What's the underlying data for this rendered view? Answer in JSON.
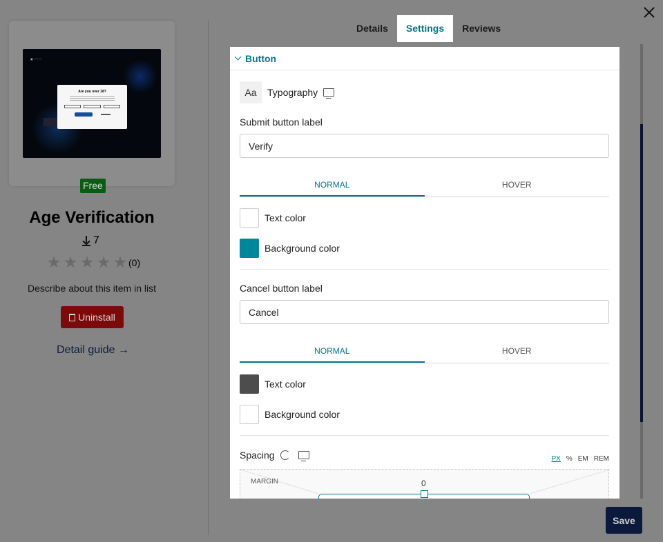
{
  "app": {
    "title": "Age Verification",
    "price_badge": "Free",
    "downloads": "7",
    "rating_count": "(0)",
    "description": "Describe about this item in list",
    "uninstall_label": "Uninstall",
    "detail_guide_label": "Detail guide →",
    "stars": 5,
    "rating_value": 0,
    "thumbnail": {
      "modal_title": "Are you over 18?"
    }
  },
  "tabs": [
    {
      "label": "Details",
      "active": false
    },
    {
      "label": "Settings",
      "active": true
    },
    {
      "label": "Reviews",
      "active": false
    }
  ],
  "panel": {
    "section_title": "Button",
    "typography_icon_text": "Aa",
    "typography_label": "Typography",
    "submit": {
      "label": "Submit button label",
      "value": "Verify",
      "state_tabs": [
        "NORMAL",
        "HOVER"
      ],
      "text_color_label": "Text color",
      "text_color": "#ffffff",
      "bg_color_label": "Background color",
      "bg_color": "#00879b"
    },
    "cancel": {
      "label": "Cancel button label",
      "value": "Cancel",
      "state_tabs": [
        "NORMAL",
        "HOVER"
      ],
      "text_color_label": "Text color",
      "text_color": "#4d4d4d",
      "bg_color_label": "Background color",
      "bg_color": "#ffffff"
    },
    "spacing": {
      "label": "Spacing",
      "units": [
        "PX",
        "%",
        "EM",
        "REM"
      ],
      "active_unit": "PX",
      "margin_label": "MARGIN",
      "margin_top_value": "0"
    }
  },
  "footer": {
    "save_label": "Save"
  },
  "colors": {
    "accent": "#00768a",
    "primary_dark": "#0b1a3c",
    "danger": "#7d0a0a",
    "success": "#085d12"
  }
}
